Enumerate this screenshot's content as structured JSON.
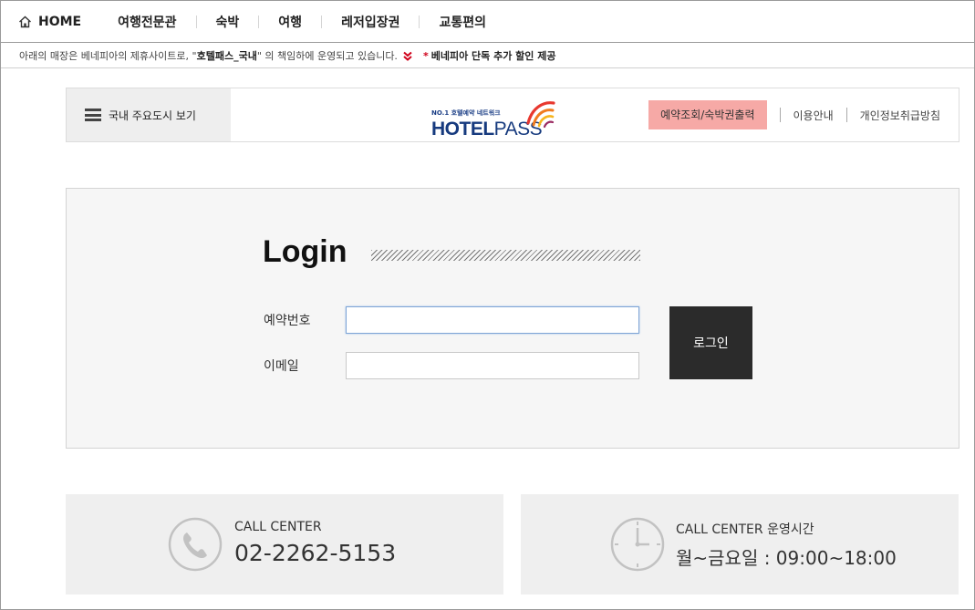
{
  "nav": {
    "home_label": "HOME",
    "items": [
      "여행전문관",
      "숙박",
      "여행",
      "레저입장권",
      "교통편의"
    ]
  },
  "notice": {
    "prefix": "아래의 매장은 베네피아의 제휴사이트로, \"",
    "site": "호텔패스_국내",
    "suffix": "\" 의 책임하에 운영되고 있습니다.",
    "promo_star": "*",
    "promo": "베네피아 단독 추가 할인 제공"
  },
  "header": {
    "city_menu_label": "국내 주요도시 보기",
    "logo_tagline": "NO.1 호텔예약 네트워크",
    "logo_bold": "HOTEL",
    "logo_regular": "PASS",
    "links": {
      "primary": "예약조회/숙박권출력",
      "guide": "이용안내",
      "privacy": "개인정보취급방침"
    }
  },
  "login": {
    "title": "Login",
    "reservation_label": "예약번호",
    "reservation_value": "",
    "email_label": "이메일",
    "email_value": "",
    "button_label": "로그인"
  },
  "info": {
    "call": {
      "caption": "CALL CENTER",
      "number": "02-2262-5153"
    },
    "hours": {
      "caption": "CALL CENTER 운영시간",
      "value": "월~금요일 : 09:00~18:00"
    }
  },
  "colors": {
    "primary_link_bg": "#f6a9a6",
    "login_button_bg": "#2b2b2b",
    "brand_blue": "#163a7e",
    "alert_red": "#d0021b"
  }
}
